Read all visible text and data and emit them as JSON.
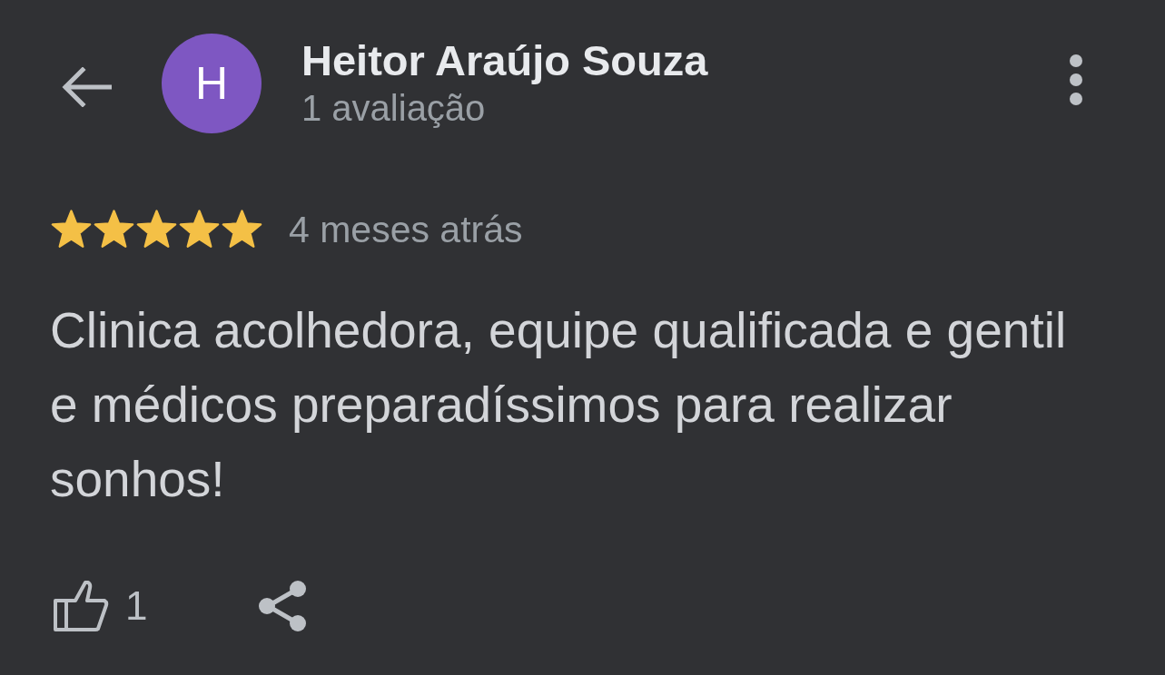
{
  "header": {
    "reviewer_name": "Heitor Araújo Souza",
    "avatar_initial": "H",
    "review_count": "1 avaliação"
  },
  "review": {
    "stars": 5,
    "time": "4 meses atrás",
    "text": "Clinica acolhedora, equipe qualificada e gentil e médicos preparadíssimos para realizar sonhos!"
  },
  "actions": {
    "like_count": "1"
  }
}
